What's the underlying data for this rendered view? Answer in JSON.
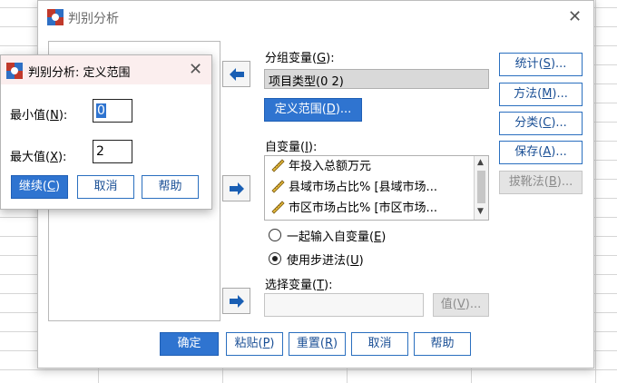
{
  "main_dialog": {
    "title": "判别分析",
    "close_glyph": "✕",
    "grouping_label": "分组变量(",
    "grouping_key": "G",
    "grouping_suffix": "):",
    "grouping_value": "项目类型(0 2)",
    "define_range_label": "定义范围(",
    "define_range_key": "D",
    "define_range_suffix": ")...",
    "independents_label": "自变量(",
    "independents_key": "I",
    "independents_suffix": "):",
    "independents": [
      "年投入总额万元",
      "县域市场占比% [县域市场...",
      "市区市场占比% [市区市场..."
    ],
    "enter_together_label": "一起输入自变量(",
    "enter_together_key": "E",
    "enter_together_suffix": ")",
    "stepwise_label": "使用步进法(",
    "stepwise_key": "U",
    "stepwise_suffix": ")",
    "selection_label": "选择变量(",
    "selection_key": "T",
    "selection_suffix": "):",
    "value_label": "值(",
    "value_key": "V",
    "value_suffix": ")...",
    "side_buttons": [
      {
        "label": "统计(",
        "key": "S",
        "suffix": ")..."
      },
      {
        "label": "方法(",
        "key": "M",
        "suffix": ")..."
      },
      {
        "label": "分类(",
        "key": "C",
        "suffix": ")..."
      },
      {
        "label": "保存(",
        "key": "A",
        "suffix": ")..."
      },
      {
        "label": "拔靴法(",
        "key": "B",
        "suffix": ")..."
      }
    ],
    "bottom_buttons": {
      "ok": "确定",
      "paste_label": "粘贴(",
      "paste_key": "P",
      "paste_suffix": ")",
      "reset_label": "重置(",
      "reset_key": "R",
      "reset_suffix": ")",
      "cancel": "取消",
      "help": "帮助"
    }
  },
  "range_dialog": {
    "title": "判别分析: 定义范围",
    "close_glyph": "✕",
    "min_label": "最小值(",
    "min_key": "N",
    "min_suffix": "):",
    "min_value": "0",
    "max_label": "最大值(",
    "max_key": "X",
    "max_suffix": "):",
    "max_value": "2",
    "continue_label": "继续(",
    "continue_key": "C",
    "continue_suffix": ")",
    "cancel": "取消",
    "help": "帮助"
  },
  "colors": {
    "accent": "#2f74d0",
    "button_border": "#2a6fbf",
    "arrow": "#1a5fb4",
    "disabled": "#e4e4e4"
  },
  "icons": {
    "app": "spss-icon",
    "arrow": "arrow-right-icon",
    "scale_variable": "ruler-icon"
  }
}
